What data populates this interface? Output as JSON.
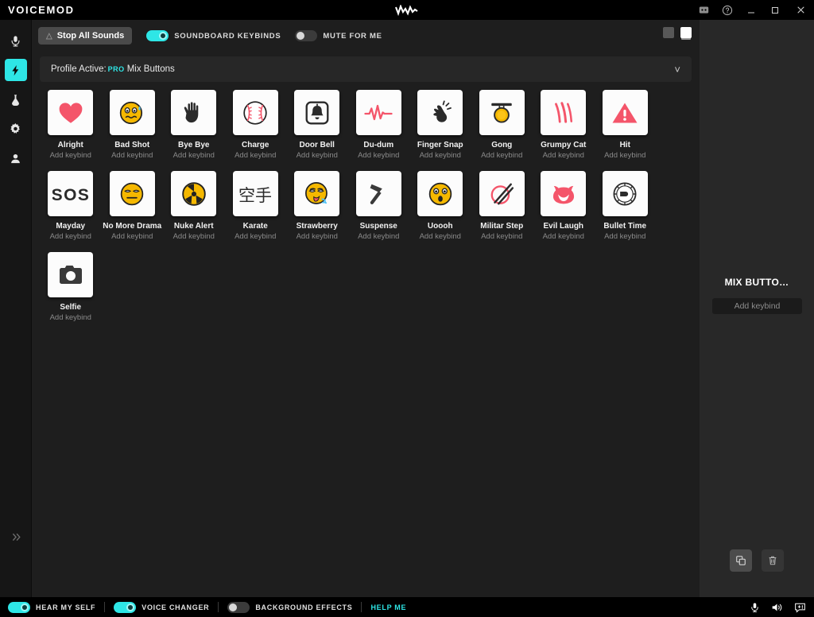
{
  "titlebar": {
    "brand": "VOICEMOD",
    "logo_icon": "vm-waveform-logo",
    "controls": [
      {
        "name": "discord-icon",
        "glyph": ""
      },
      {
        "name": "help-icon",
        "glyph": "?"
      },
      {
        "name": "minimize-icon",
        "glyph": "—"
      },
      {
        "name": "maximize-icon",
        "glyph": "□"
      },
      {
        "name": "close-icon",
        "glyph": "✕"
      }
    ]
  },
  "sidebar": {
    "items": [
      {
        "name": "sidebar-item-voice",
        "icon": "microphone-icon",
        "active": false
      },
      {
        "name": "sidebar-item-soundboard",
        "icon": "lightning-bolt-icon",
        "active": true
      },
      {
        "name": "sidebar-item-voicelab",
        "icon": "flask-icon",
        "active": false
      },
      {
        "name": "sidebar-item-settings",
        "icon": "gear-icon",
        "active": false
      },
      {
        "name": "sidebar-item-account",
        "icon": "person-icon",
        "active": false
      }
    ],
    "expand_icon": "chevron-double-right-icon"
  },
  "toolbar": {
    "stop_all_label": "Stop All Sounds",
    "stop_all_icon": "warning-triangle-icon",
    "soundboard_keybinds_label": "SOUNDBOARD KEYBINDS",
    "soundboard_keybinds_on": true,
    "mute_for_me_label": "MUTE FOR ME",
    "mute_for_me_on": false,
    "view_mode_grid_active": false,
    "view_mode_large_active": true
  },
  "profile": {
    "prefix": "Profile Active:",
    "badge": "PRO",
    "name": "Mix Buttons",
    "chevron_icon": "chevron-down-icon"
  },
  "soundboard": {
    "keybind_label": "Add keybind",
    "sounds": [
      {
        "name": "Alright",
        "icon": "heart-icon"
      },
      {
        "name": "Bad Shot",
        "icon": "sweat-face-icon"
      },
      {
        "name": "Bye Bye",
        "icon": "waving-hand-icon"
      },
      {
        "name": "Charge",
        "icon": "baseball-icon"
      },
      {
        "name": "Door Bell",
        "icon": "doorbell-icon"
      },
      {
        "name": "Du-dum",
        "icon": "heartbeat-pulse-icon"
      },
      {
        "name": "Finger Snap",
        "icon": "snapping-fingers-icon"
      },
      {
        "name": "Gong",
        "icon": "gong-icon"
      },
      {
        "name": "Grumpy Cat",
        "icon": "claw-scratch-icon"
      },
      {
        "name": "Hit",
        "icon": "warning-triangle-icon"
      },
      {
        "name": "Mayday",
        "icon": "sos-icon"
      },
      {
        "name": "No More Drama",
        "icon": "unamused-face-icon"
      },
      {
        "name": "Nuke Alert",
        "icon": "radioactive-icon"
      },
      {
        "name": "Karate",
        "icon": "karate-kanji-icon"
      },
      {
        "name": "Strawberry",
        "icon": "tongue-out-face-icon"
      },
      {
        "name": "Suspense",
        "icon": "hammer-icon"
      },
      {
        "name": "Uoooh",
        "icon": "surprised-face-icon"
      },
      {
        "name": "Militar Step",
        "icon": "drum-sticks-icon"
      },
      {
        "name": "Evil Laugh",
        "icon": "devil-face-icon"
      },
      {
        "name": "Bullet Time",
        "icon": "bullet-clock-icon"
      },
      {
        "name": "Selfie",
        "icon": "camera-icon"
      }
    ]
  },
  "rightpanel": {
    "title": "MIX BUTTO…",
    "keybind_label": "Add keybind",
    "copy_icon": "duplicate-icon",
    "delete_icon": "trash-icon"
  },
  "bottombar": {
    "hear_myself_label": "HEAR MY SELF",
    "hear_myself_on": true,
    "voice_changer_label": "VOICE CHANGER",
    "voice_changer_on": true,
    "background_effects_label": "BACKGROUND EFFECTS",
    "background_effects_on": false,
    "help_label": "HELP ME",
    "icons": [
      {
        "name": "microphone-icon"
      },
      {
        "name": "speaker-icon"
      },
      {
        "name": "feedback-chat-icon"
      }
    ]
  },
  "colors": {
    "accent": "#2ee6e6",
    "bg": "#1e1e1e",
    "panel": "#282828",
    "tile": "#fcfcfc",
    "red": "#f4556a",
    "yellow": "#f5b800"
  }
}
